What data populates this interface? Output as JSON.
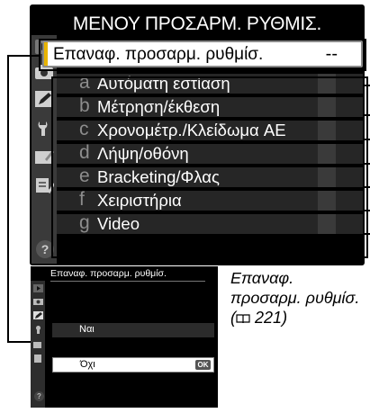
{
  "menu": {
    "title": "ΜΕΝΟΥ ΠΡΟΣΑΡΜ. ΡΥΘΜΙΣ.",
    "reset": {
      "label": "Επαναφ. προσαρμ. ρυθμίσ.",
      "value": "--"
    },
    "items": [
      {
        "letter": "a",
        "label": "Αυτόματη εστίαση"
      },
      {
        "letter": "b",
        "label": "Μέτρηση/έκθεση"
      },
      {
        "letter": "c",
        "label": "Χρονομέτρ./Κλείδωμα AE"
      },
      {
        "letter": "d",
        "label": "Λήψη/οθόνη"
      },
      {
        "letter": "e",
        "label": "Bracketing/Φλας"
      },
      {
        "letter": "f",
        "label": "Χειριστήρια"
      },
      {
        "letter": "g",
        "label": "Video"
      }
    ],
    "tabs": [
      "playback-icon",
      "camera-icon",
      "pencil-icon",
      "wrench-icon",
      "retouch-icon",
      "my-menu-icon"
    ],
    "help": "?"
  },
  "submenu": {
    "title": "Επαναφ. προσαρμ. ρυθμίσ.",
    "options": [
      {
        "label": "Ναι"
      },
      {
        "label": "Όχι",
        "ok": "OK"
      }
    ],
    "help": "?"
  },
  "caption": {
    "text": "Επαναφ. προσαρμ. ρυθμίσ.",
    "ref_icon": "book-icon",
    "ref": "221"
  },
  "colors": {
    "accent": "#e8b400",
    "screen_bg": "#000000",
    "item_bg": "#262626"
  }
}
